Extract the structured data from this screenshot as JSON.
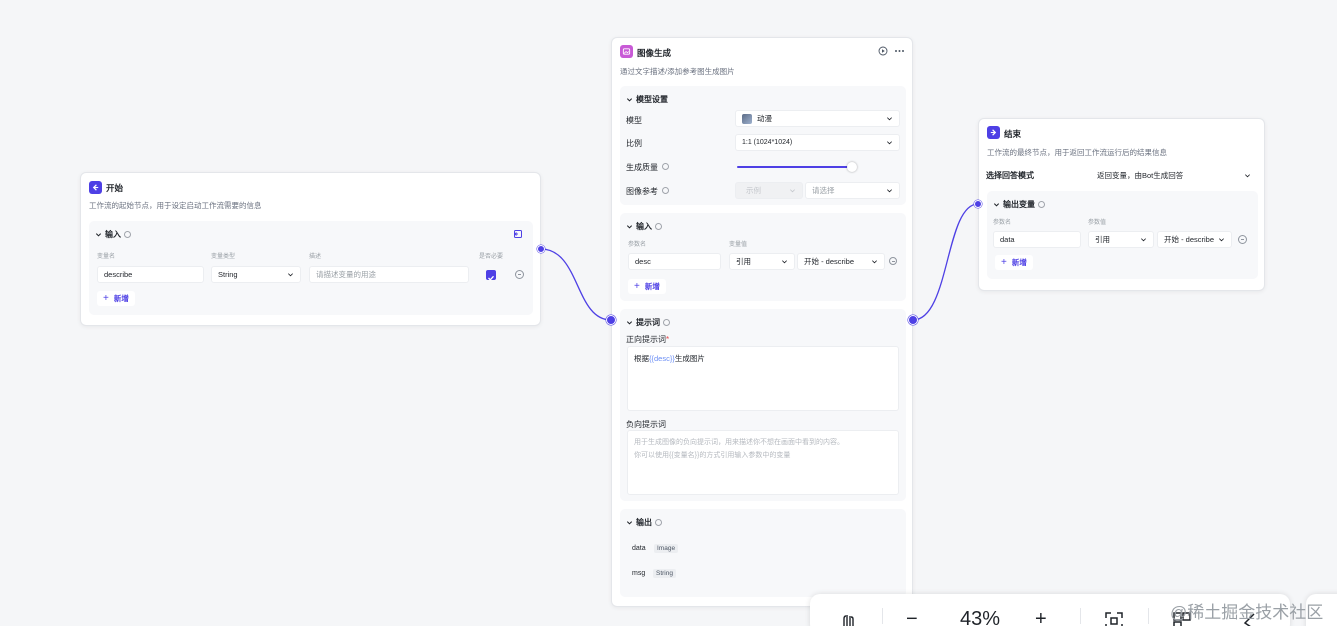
{
  "start_node": {
    "title": "开始",
    "desc": "工作流的起始节点，用于设定启动工作流需要的信息",
    "input_section": {
      "title": "输入",
      "col_name": "变量名",
      "col_type": "变量类型",
      "col_desc": "描述",
      "col_required": "是否必要",
      "row": {
        "name": "describe",
        "type": "String",
        "desc_placeholder": "请描述变量的用途",
        "required": true
      },
      "add_label": "新增"
    }
  },
  "image_node": {
    "title": "图像生成",
    "desc": "通过文字描述/添加参考图生成图片",
    "model_section": {
      "title": "模型设置",
      "model_label": "模型",
      "model_value": "动漫",
      "ratio_label": "比例",
      "ratio_value": "1:1 (1024*1024)",
      "quality_label": "生成质量",
      "quality_level": 0.95,
      "ref_label": "图像参考",
      "ref_disabled": "示例",
      "ref_select_placeholder": "请选择"
    },
    "input_section": {
      "title": "输入",
      "col_name": "参数名",
      "col_value": "变量值",
      "row": {
        "name": "desc",
        "mode": "引用",
        "ref": "开始 - describe"
      },
      "add_label": "新增"
    },
    "prompt_section": {
      "title": "提示词",
      "positive_label": "正向提示词",
      "required_mark": "*",
      "positive_prefix": "根据",
      "positive_var": "{{desc}}",
      "positive_suffix": "生成图片",
      "negative_label": "负向提示词",
      "negative_placeholder_line1": "用于生成图像的负向提示词，用来描述你不想在画面中看到的内容。",
      "negative_placeholder_line2": "你可以使用{{变量名}}的方式引用输入参数中的变量"
    },
    "output_section": {
      "title": "输出",
      "rows": [
        {
          "name": "data",
          "type": "Image"
        },
        {
          "name": "msg",
          "type": "String"
        }
      ]
    }
  },
  "end_node": {
    "title": "结束",
    "desc": "工作流的最终节点，用于返回工作流运行后的结果信息",
    "mode_label": "选择回答模式",
    "mode_value": "返回变量，由Bot生成回答",
    "output_section": {
      "title": "输出变量",
      "col_name": "参数名",
      "col_value": "参数值",
      "row": {
        "name": "data",
        "mode": "引用",
        "ref": "开始 - describe"
      },
      "add_label": "新增"
    }
  },
  "toolbar": {
    "zoom": "43%",
    "minus": "−",
    "plus": "+"
  },
  "watermark": "@稀土掘金技术社区",
  "colors": {
    "accent": "#4e40e5",
    "canvas": "#f5f6f8",
    "image_icon": "#c85ad6"
  }
}
